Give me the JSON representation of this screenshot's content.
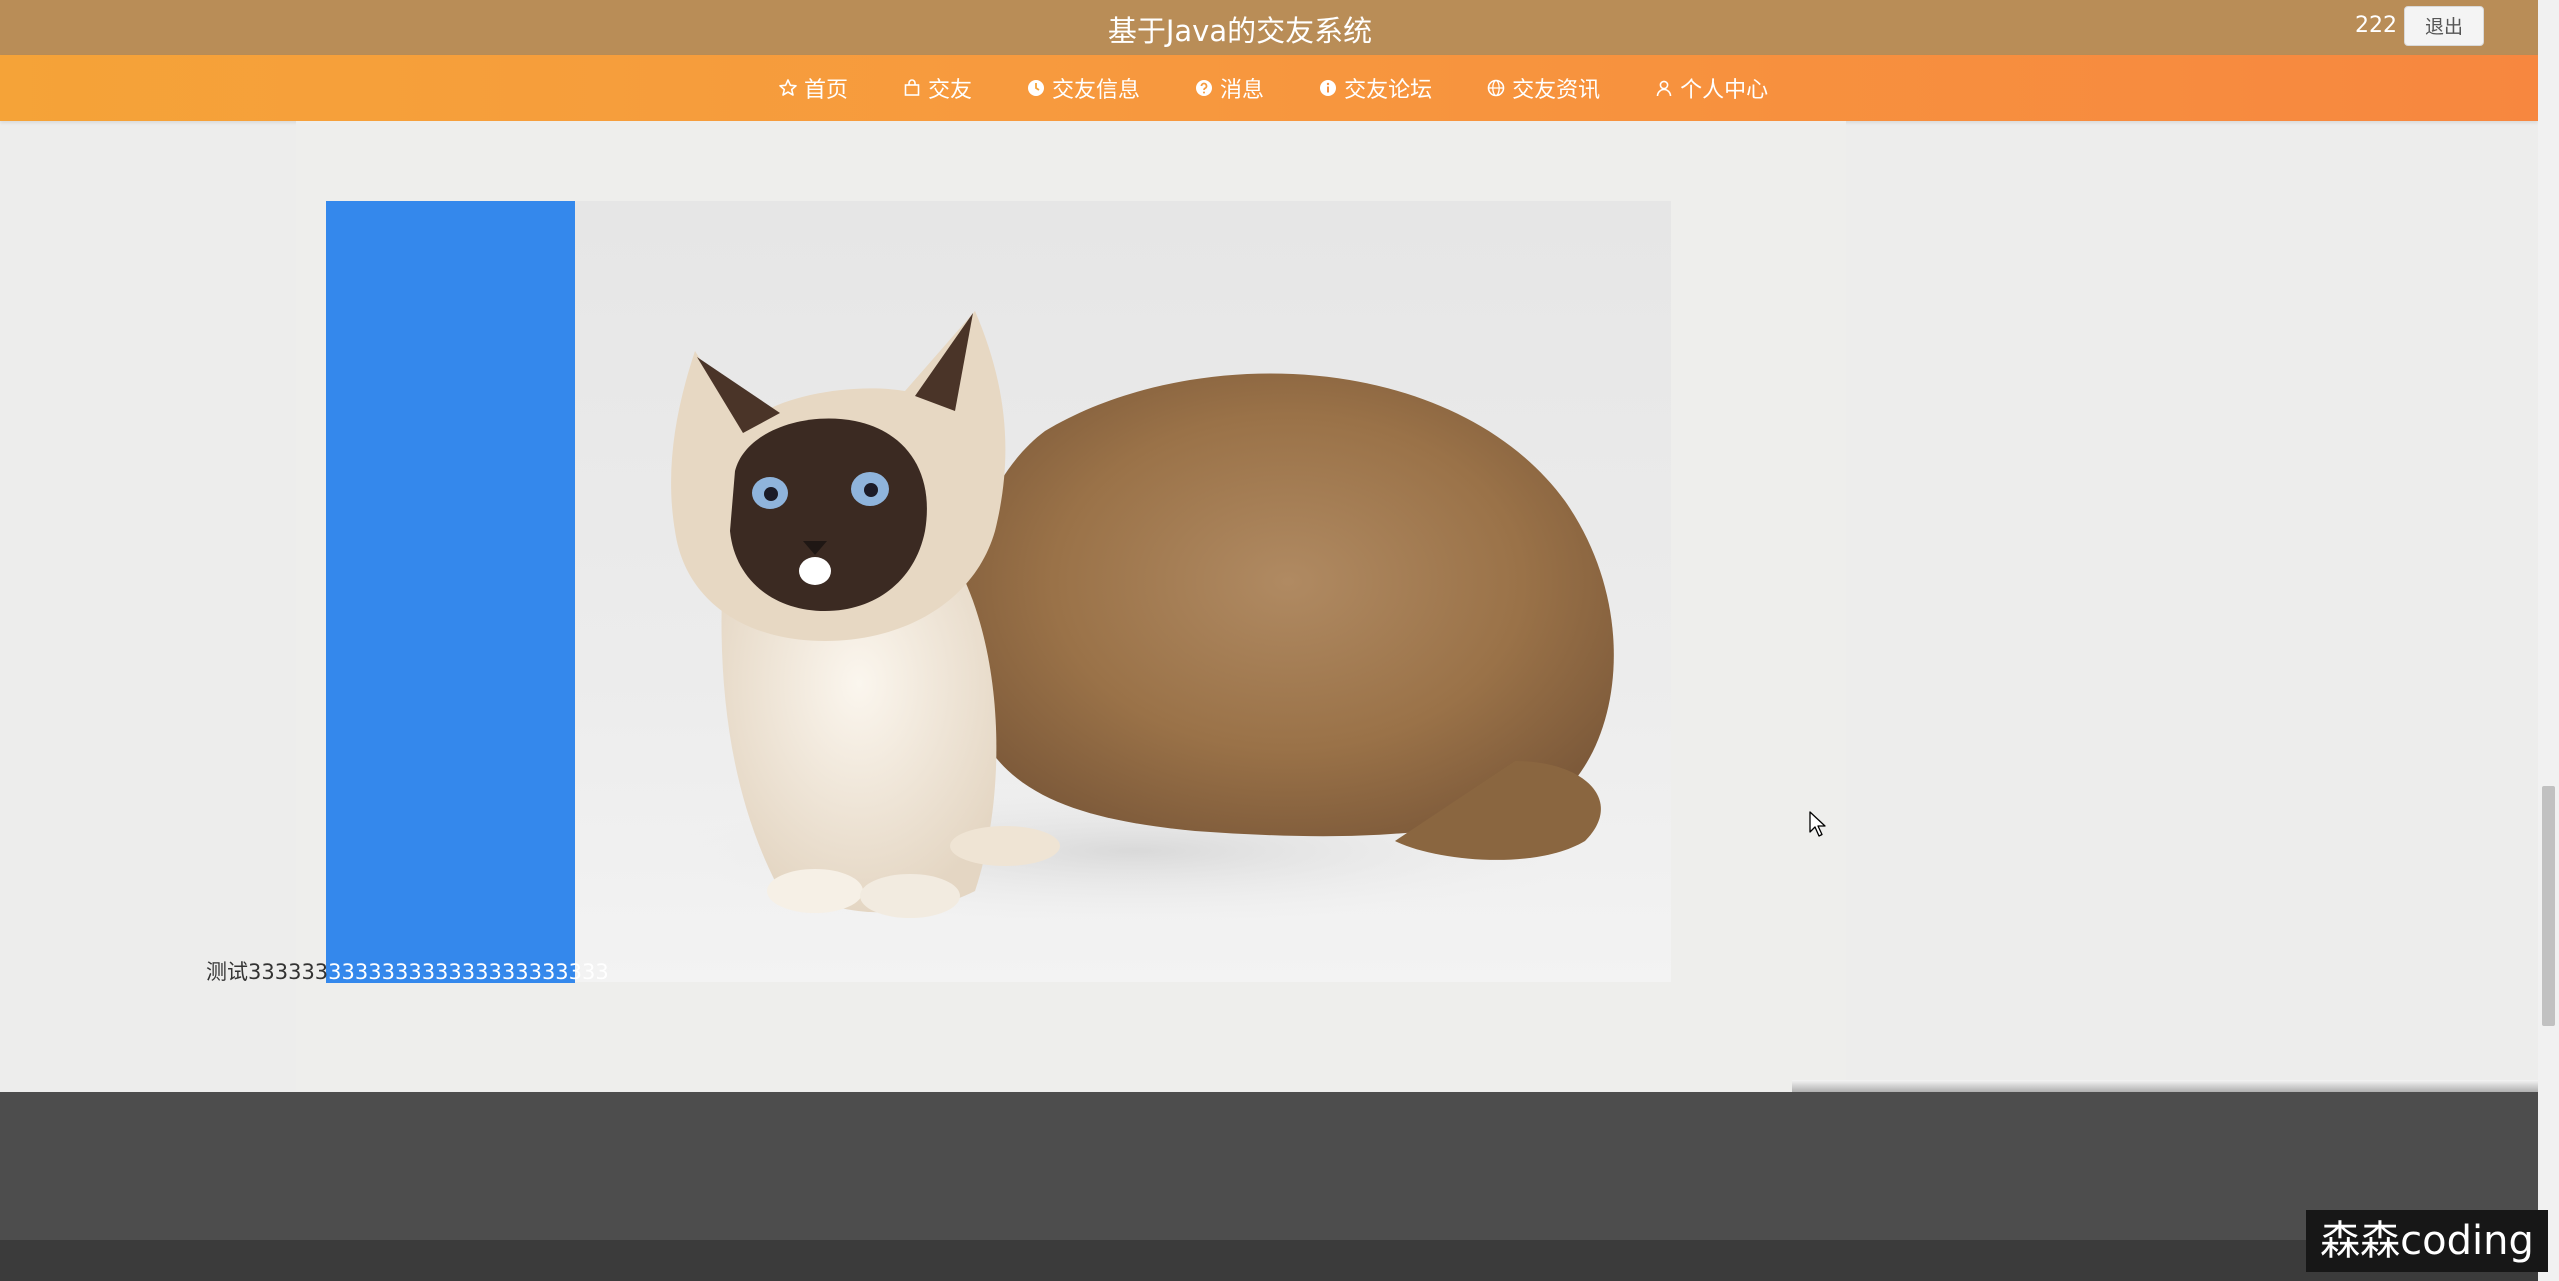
{
  "header": {
    "title": "基于Java的交友系统",
    "username": "222",
    "logout_label": "退出"
  },
  "nav": {
    "items": [
      {
        "label": "首页",
        "icon": "star-icon"
      },
      {
        "label": "交友",
        "icon": "bag-icon"
      },
      {
        "label": "交友信息",
        "icon": "clock-icon"
      },
      {
        "label": "消息",
        "icon": "question-icon"
      },
      {
        "label": "交友论坛",
        "icon": "info-icon"
      },
      {
        "label": "交友资讯",
        "icon": "globe-icon"
      },
      {
        "label": "个人中心",
        "icon": "user-icon"
      }
    ]
  },
  "carousel": {
    "caption_plain": "测试333333",
    "caption_highlight": "333333333333333333333",
    "image_subject": "Birman cat"
  },
  "watermark": {
    "label": "森森coding"
  },
  "colors": {
    "title_bar": "#b98d57",
    "nav_start": "#f5a338",
    "nav_end": "#f7873f",
    "slide_blue": "#3488ec",
    "footer": "#4d4d4d"
  }
}
